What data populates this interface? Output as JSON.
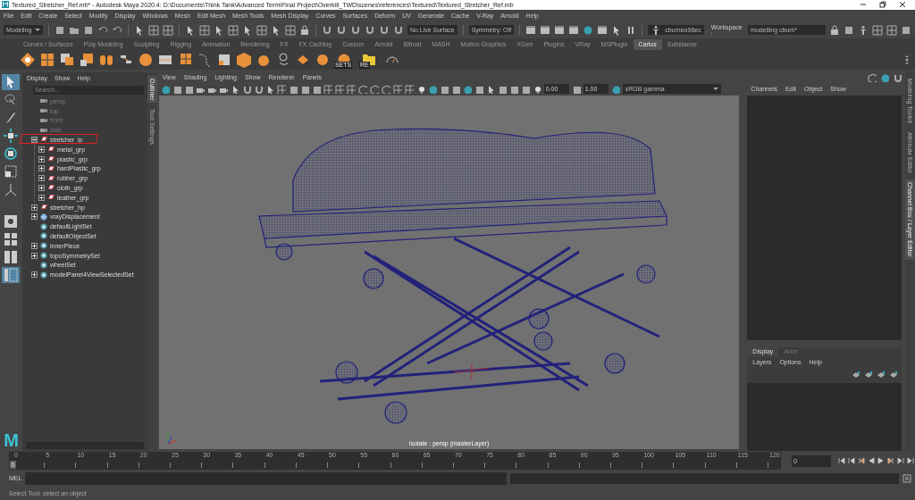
{
  "window": {
    "title": "Textured_Stretcher_Ref.mb* - Autodesk Maya 2020.4: D:\\Documents\\Think Tank\\Advanced Term\\Final Project\\Overkill_TWD\\scenes\\references\\Textured\\Textured_Stretcher_Ref.mb"
  },
  "menu_bar": [
    "File",
    "Edit",
    "Create",
    "Select",
    "Modify",
    "Display",
    "Windows",
    "Mesh",
    "Edit Mesh",
    "Mesh Tools",
    "Mesh Display",
    "Curves",
    "Surfaces",
    "Deform",
    "UV",
    "Generate",
    "Cache",
    "V-Ray",
    "Arnold",
    "Help"
  ],
  "status_line": {
    "mode": "Modeling",
    "live_surface": "No Live Surface",
    "symmetry": "Symmetry: Off",
    "account": "cburneo96ec",
    "workspace_label": "Workspace :",
    "workspace": "modelling cburn*"
  },
  "shelf": {
    "tabs": [
      {
        "label": "Curves / Surfaces",
        "selected": false
      },
      {
        "label": "Poly Modeling",
        "selected": false
      },
      {
        "label": "Sculpting",
        "selected": false
      },
      {
        "label": "Rigging",
        "selected": false
      },
      {
        "label": "Animation",
        "selected": false
      },
      {
        "label": "Rendering",
        "selected": false
      },
      {
        "label": "FX",
        "selected": false
      },
      {
        "label": "FX Caching",
        "selected": false
      },
      {
        "label": "Custom",
        "selected": false
      },
      {
        "label": "Arnold",
        "selected": false
      },
      {
        "label": "Bifrost",
        "selected": false
      },
      {
        "label": "MASH",
        "selected": false
      },
      {
        "label": "Motion Graphics",
        "selected": false
      },
      {
        "label": "XGen",
        "selected": false
      },
      {
        "label": "Plugins",
        "selected": false
      },
      {
        "label": "VRay",
        "selected": false
      },
      {
        "label": "MSPlugin",
        "selected": false
      },
      {
        "label": "Carlos",
        "selected": true
      },
      {
        "label": "Substance",
        "selected": false
      }
    ],
    "labeled_buttons": [
      {
        "label": "SETS"
      },
      {
        "label": "RE"
      }
    ]
  },
  "toolbox": {
    "tools": [
      {
        "kind": "select",
        "selected": true
      },
      {
        "kind": "lasso",
        "selected": false
      },
      {
        "kind": "paint",
        "selected": false
      },
      {
        "kind": "move",
        "selected": false
      },
      {
        "kind": "rotate",
        "selected": false
      },
      {
        "kind": "scale",
        "selected": false
      },
      {
        "kind": "manipulator",
        "selected": false
      }
    ],
    "layouts": [
      {
        "kind": "single",
        "selected": false
      },
      {
        "kind": "four",
        "selected": false
      },
      {
        "kind": "two",
        "selected": false
      },
      {
        "kind": "outliner",
        "selected": true
      }
    ]
  },
  "logo": "M",
  "outliner": {
    "menu": [
      "Display",
      "Show",
      "Help"
    ],
    "search": {
      "placeholder": "Search..."
    },
    "items": [
      {
        "label": "persp",
        "kind": "camera",
        "dimmed": true,
        "annotated": false
      },
      {
        "label": "top",
        "kind": "camera",
        "dimmed": true,
        "annotated": false
      },
      {
        "label": "front",
        "kind": "camera",
        "dimmed": true,
        "annotated": false
      },
      {
        "label": "side",
        "kind": "camera",
        "dimmed": true,
        "annotated": false
      },
      {
        "label": "stretcher_lp",
        "kind": "group",
        "dimmed": false,
        "annotated": true,
        "expanded": true,
        "children": [
          {
            "label": "metal_grp",
            "kind": "group",
            "dimmed": false,
            "annotated": false,
            "expanded": false
          },
          {
            "label": "plastic_grp",
            "kind": "group",
            "dimmed": false,
            "annotated": false,
            "expanded": false
          },
          {
            "label": "hardPlastic_grp",
            "kind": "group",
            "dimmed": false,
            "annotated": false,
            "expanded": false
          },
          {
            "label": "rubber_grp",
            "kind": "group",
            "dimmed": false,
            "annotated": false,
            "expanded": false
          },
          {
            "label": "cloth_grp",
            "kind": "group",
            "dimmed": false,
            "annotated": false,
            "expanded": false
          },
          {
            "label": "leather_grp",
            "kind": "group",
            "dimmed": false,
            "annotated": false,
            "expanded": false
          }
        ]
      },
      {
        "label": "stretcher_hp",
        "kind": "group",
        "dimmed": false,
        "annotated": false,
        "expanded": false
      },
      {
        "label": "vrayDisplacement",
        "kind": "vray",
        "dimmed": false,
        "annotated": false,
        "expanded": false
      },
      {
        "label": "defaultLightSet",
        "kind": "set",
        "dimmed": false,
        "annotated": false
      },
      {
        "label": "defaultObjectSet",
        "kind": "set",
        "dimmed": false,
        "annotated": false
      },
      {
        "label": "innerPiece",
        "kind": "set",
        "dimmed": false,
        "annotated": false,
        "expanded": false
      },
      {
        "label": "topoSymmetrySet",
        "kind": "set",
        "dimmed": false,
        "annotated": false,
        "expanded": false
      },
      {
        "label": "wheelSet",
        "kind": "set",
        "dimmed": false,
        "annotated": false
      },
      {
        "label": "modelPanel4ViewSelectedSet",
        "kind": "set",
        "dimmed": false,
        "annotated": false,
        "expanded": false
      }
    ]
  },
  "side_tabs": [
    {
      "label": "Outliner",
      "selected": true
    },
    {
      "label": "Tool Settings",
      "selected": false
    }
  ],
  "viewport": {
    "menu": [
      "View",
      "Shading",
      "Lighting",
      "Show",
      "Renderer",
      "Panels"
    ],
    "exposure": "0.00",
    "gamma": "1.00",
    "color_space": "sRGB gamma",
    "caption": "Isolate : persp (masterLayer)"
  },
  "channel_box": {
    "menu": [
      "Channels",
      "Edit",
      "Object",
      "Show"
    ]
  },
  "layer_editor": {
    "tabs": [
      {
        "label": "Display",
        "selected": true
      },
      {
        "label": "Anim",
        "selected": false
      }
    ],
    "menu": [
      "Layers",
      "Options",
      "Help"
    ]
  },
  "right_tabs": [
    {
      "label": "Modeling Toolkit",
      "selected": false
    },
    {
      "label": "Attribute Editor",
      "selected": false
    },
    {
      "label": "Channel Box / Layer Editor",
      "selected": true
    }
  ],
  "timeline": {
    "level": 0,
    "ticks": [
      "0",
      "5",
      "10",
      "15",
      "20",
      "25",
      "30",
      "35",
      "40",
      "45",
      "50",
      "55",
      "60",
      "65",
      "70",
      "75",
      "80",
      "85",
      "90",
      "95",
      "100",
      "105",
      "110",
      "115",
      "120"
    ],
    "current_frame": "0",
    "frame_field": "0"
  },
  "command_line": {
    "language": "MEL"
  },
  "help_line": "Select Tool: select an object"
}
